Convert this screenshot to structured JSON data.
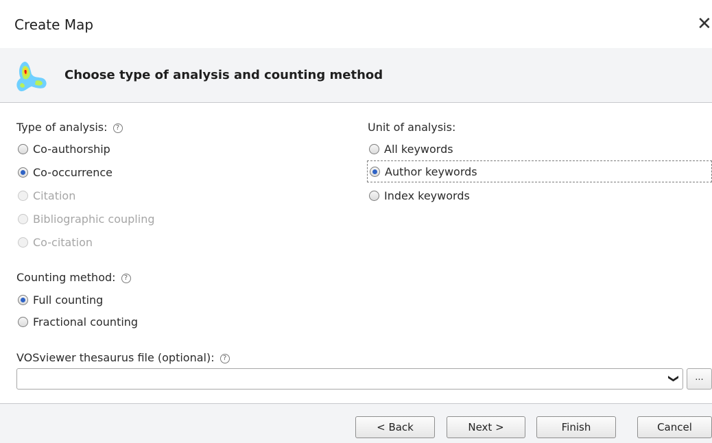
{
  "window": {
    "title": "Create Map"
  },
  "header": {
    "subtitle": "Choose type of analysis and counting method"
  },
  "analysis_type": {
    "label": "Type of analysis:",
    "options": [
      {
        "label": "Co-authorship",
        "checked": false,
        "enabled": true
      },
      {
        "label": "Co-occurrence",
        "checked": true,
        "enabled": true
      },
      {
        "label": "Citation",
        "checked": false,
        "enabled": false
      },
      {
        "label": "Bibliographic coupling",
        "checked": false,
        "enabled": false
      },
      {
        "label": "Co-citation",
        "checked": false,
        "enabled": false
      }
    ]
  },
  "unit_of_analysis": {
    "label": "Unit of analysis:",
    "options": [
      {
        "label": "All keywords",
        "checked": false
      },
      {
        "label": "Author keywords",
        "checked": true
      },
      {
        "label": "Index keywords",
        "checked": false
      }
    ]
  },
  "counting_method": {
    "label": "Counting method:",
    "options": [
      {
        "label": "Full counting",
        "checked": true
      },
      {
        "label": "Fractional counting",
        "checked": false
      }
    ]
  },
  "thesaurus": {
    "label": "VOSviewer thesaurus file (optional):",
    "value": "",
    "browse_label": "..."
  },
  "buttons": {
    "back": "< Back",
    "next": "Next >",
    "finish": "Finish",
    "cancel": "Cancel"
  },
  "help_glyph": "?",
  "colors": {
    "accent": "#2f63c5",
    "disabled_text": "#a6a6a6"
  }
}
